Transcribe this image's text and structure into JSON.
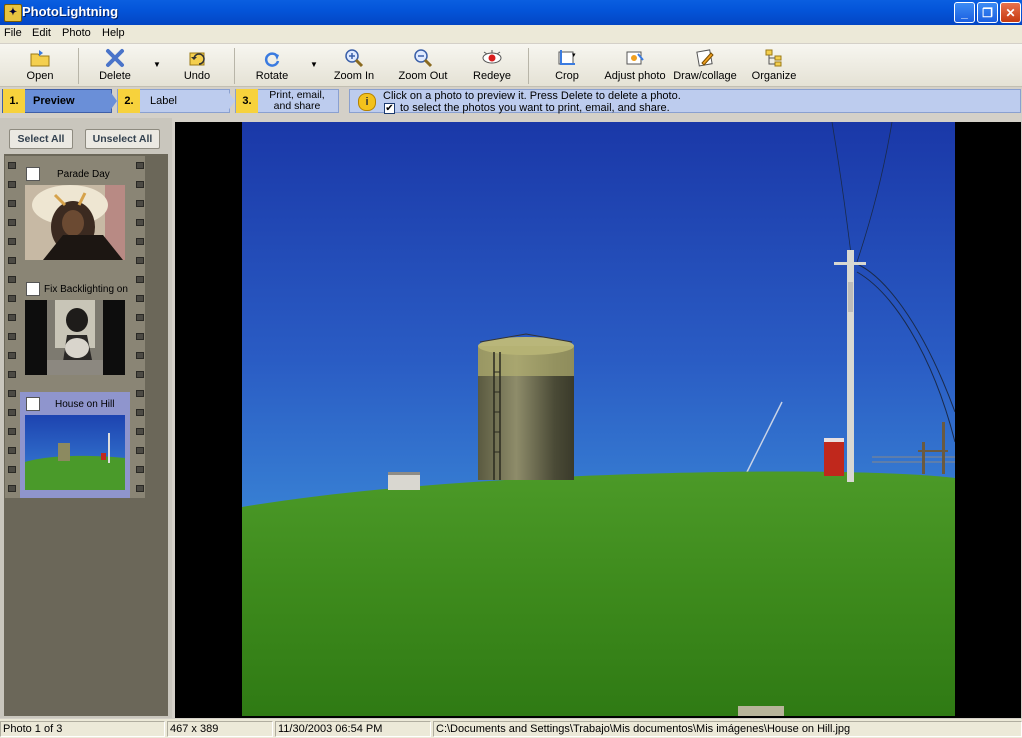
{
  "window": {
    "title": "PhotoLightning",
    "icon": "camera-app-icon",
    "controls": [
      "minimize",
      "restore",
      "close"
    ]
  },
  "menu": [
    "File",
    "Edit",
    "Photo",
    "Help"
  ],
  "toolbar": {
    "open": "Open",
    "delete": "Delete",
    "undo": "Undo",
    "rotate": "Rotate",
    "zoom_in": "Zoom In",
    "zoom_out": "Zoom Out",
    "redeye": "Redeye",
    "crop": "Crop",
    "adjust": "Adjust photo",
    "draw": "Draw/collage",
    "organize": "Organize"
  },
  "steps": [
    {
      "num": "1.",
      "label": "Preview"
    },
    {
      "num": "2.",
      "label": "Label"
    },
    {
      "num": "3.",
      "label_line1": "Print, email,",
      "label_line2": "and share"
    }
  ],
  "info": {
    "line1": "Click on a photo to preview it.  Press Delete to delete a photo.",
    "line2": "to select the photos you want to print, email, and share."
  },
  "selection": {
    "select_all": "Select All",
    "unselect_all": "Unselect All"
  },
  "photos": [
    {
      "title": "Parade Day",
      "checked": false,
      "selected": false
    },
    {
      "title": "Fix Backlighting on",
      "checked": false,
      "selected": false
    },
    {
      "title": "House on Hill",
      "checked": false,
      "selected": true
    }
  ],
  "status": {
    "count": "Photo 1 of 3",
    "dimensions": "467 x 389",
    "datetime": "11/30/2003  06:54 PM",
    "path": "C:\\Documents and Settings\\Trabajo\\Mis documentos\\Mis imágenes\\House on Hill.jpg"
  },
  "colors": {
    "titlebar": "#0455d9",
    "step_active": "#6a8fd8",
    "step_num": "#f7d23c",
    "sky": "#2f5fc0",
    "grass": "#3f8f20"
  }
}
